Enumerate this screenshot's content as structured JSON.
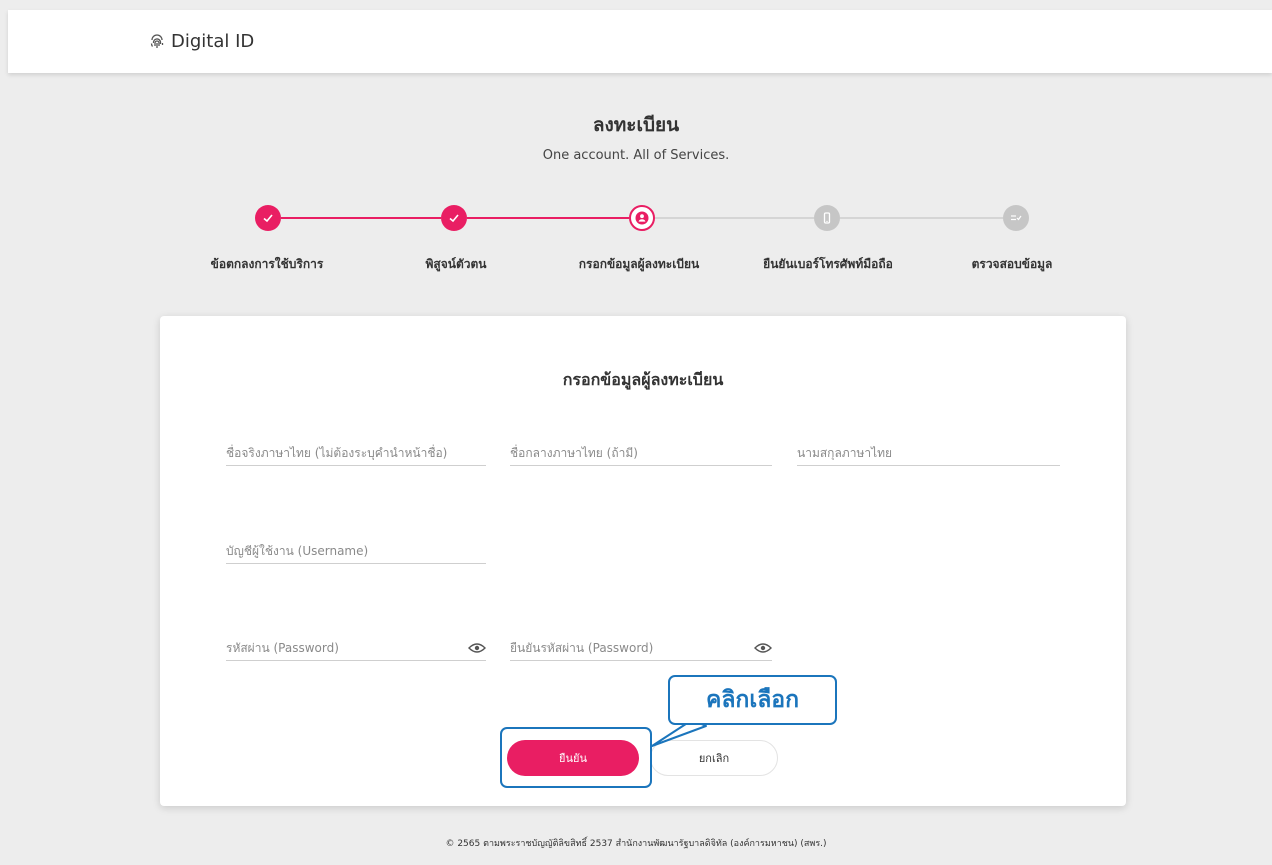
{
  "header": {
    "brand": "Digital ID"
  },
  "page": {
    "title": "ลงทะเบียน",
    "subtitle": "One account. All of Services."
  },
  "steps": [
    {
      "label": "ข้อตกลงการใช้บริการ",
      "state": "done"
    },
    {
      "label": "พิสูจน์ตัวตน",
      "state": "done"
    },
    {
      "label": "กรอกข้อมูลผู้ลงทะเบียน",
      "state": "current"
    },
    {
      "label": "ยืนยันเบอร์โทรศัพท์มือถือ",
      "state": "todo"
    },
    {
      "label": "ตรวจสอบข้อมูล",
      "state": "todo"
    }
  ],
  "form": {
    "title": "กรอกข้อมูลผู้ลงทะเบียน",
    "first_name": {
      "placeholder": "ชื่อจริงภาษาไทย (ไม่ต้องระบุคำนำหน้าชื่อ)",
      "value": ""
    },
    "middle_name": {
      "placeholder": "ชื่อกลางภาษาไทย (ถ้ามี)",
      "value": ""
    },
    "last_name": {
      "placeholder": "นามสกุลภาษาไทย",
      "value": ""
    },
    "username": {
      "placeholder": "บัญชีผู้ใช้งาน (Username)",
      "value": ""
    },
    "password": {
      "placeholder": "รหัสผ่าน (Password)",
      "value": ""
    },
    "confirm_password": {
      "placeholder": "ยืนยันรหัสผ่าน (Password)",
      "value": ""
    },
    "confirm_label": "ยืนยัน",
    "cancel_label": "ยกเลิก"
  },
  "annotation": {
    "callout_text": "คลิกเลือก"
  },
  "footer": {
    "text": "© 2565 ตามพระราชบัญญัติลิขสิทธิ์ 2537 สำนักงานพัฒนารัฐบาลดิจิทัล (องค์การมหาชน) (สพร.)"
  },
  "colors": {
    "accent": "#e91e63",
    "inactive": "#c6c6c6",
    "annotation": "#1b75bc"
  },
  "icons": {
    "brand": "fingerprint-icon",
    "step_done": "check-icon",
    "step_current": "user-icon",
    "step_phone": "mobile-phone-icon",
    "step_review": "checklist-icon",
    "password_toggle": "eye-icon"
  }
}
